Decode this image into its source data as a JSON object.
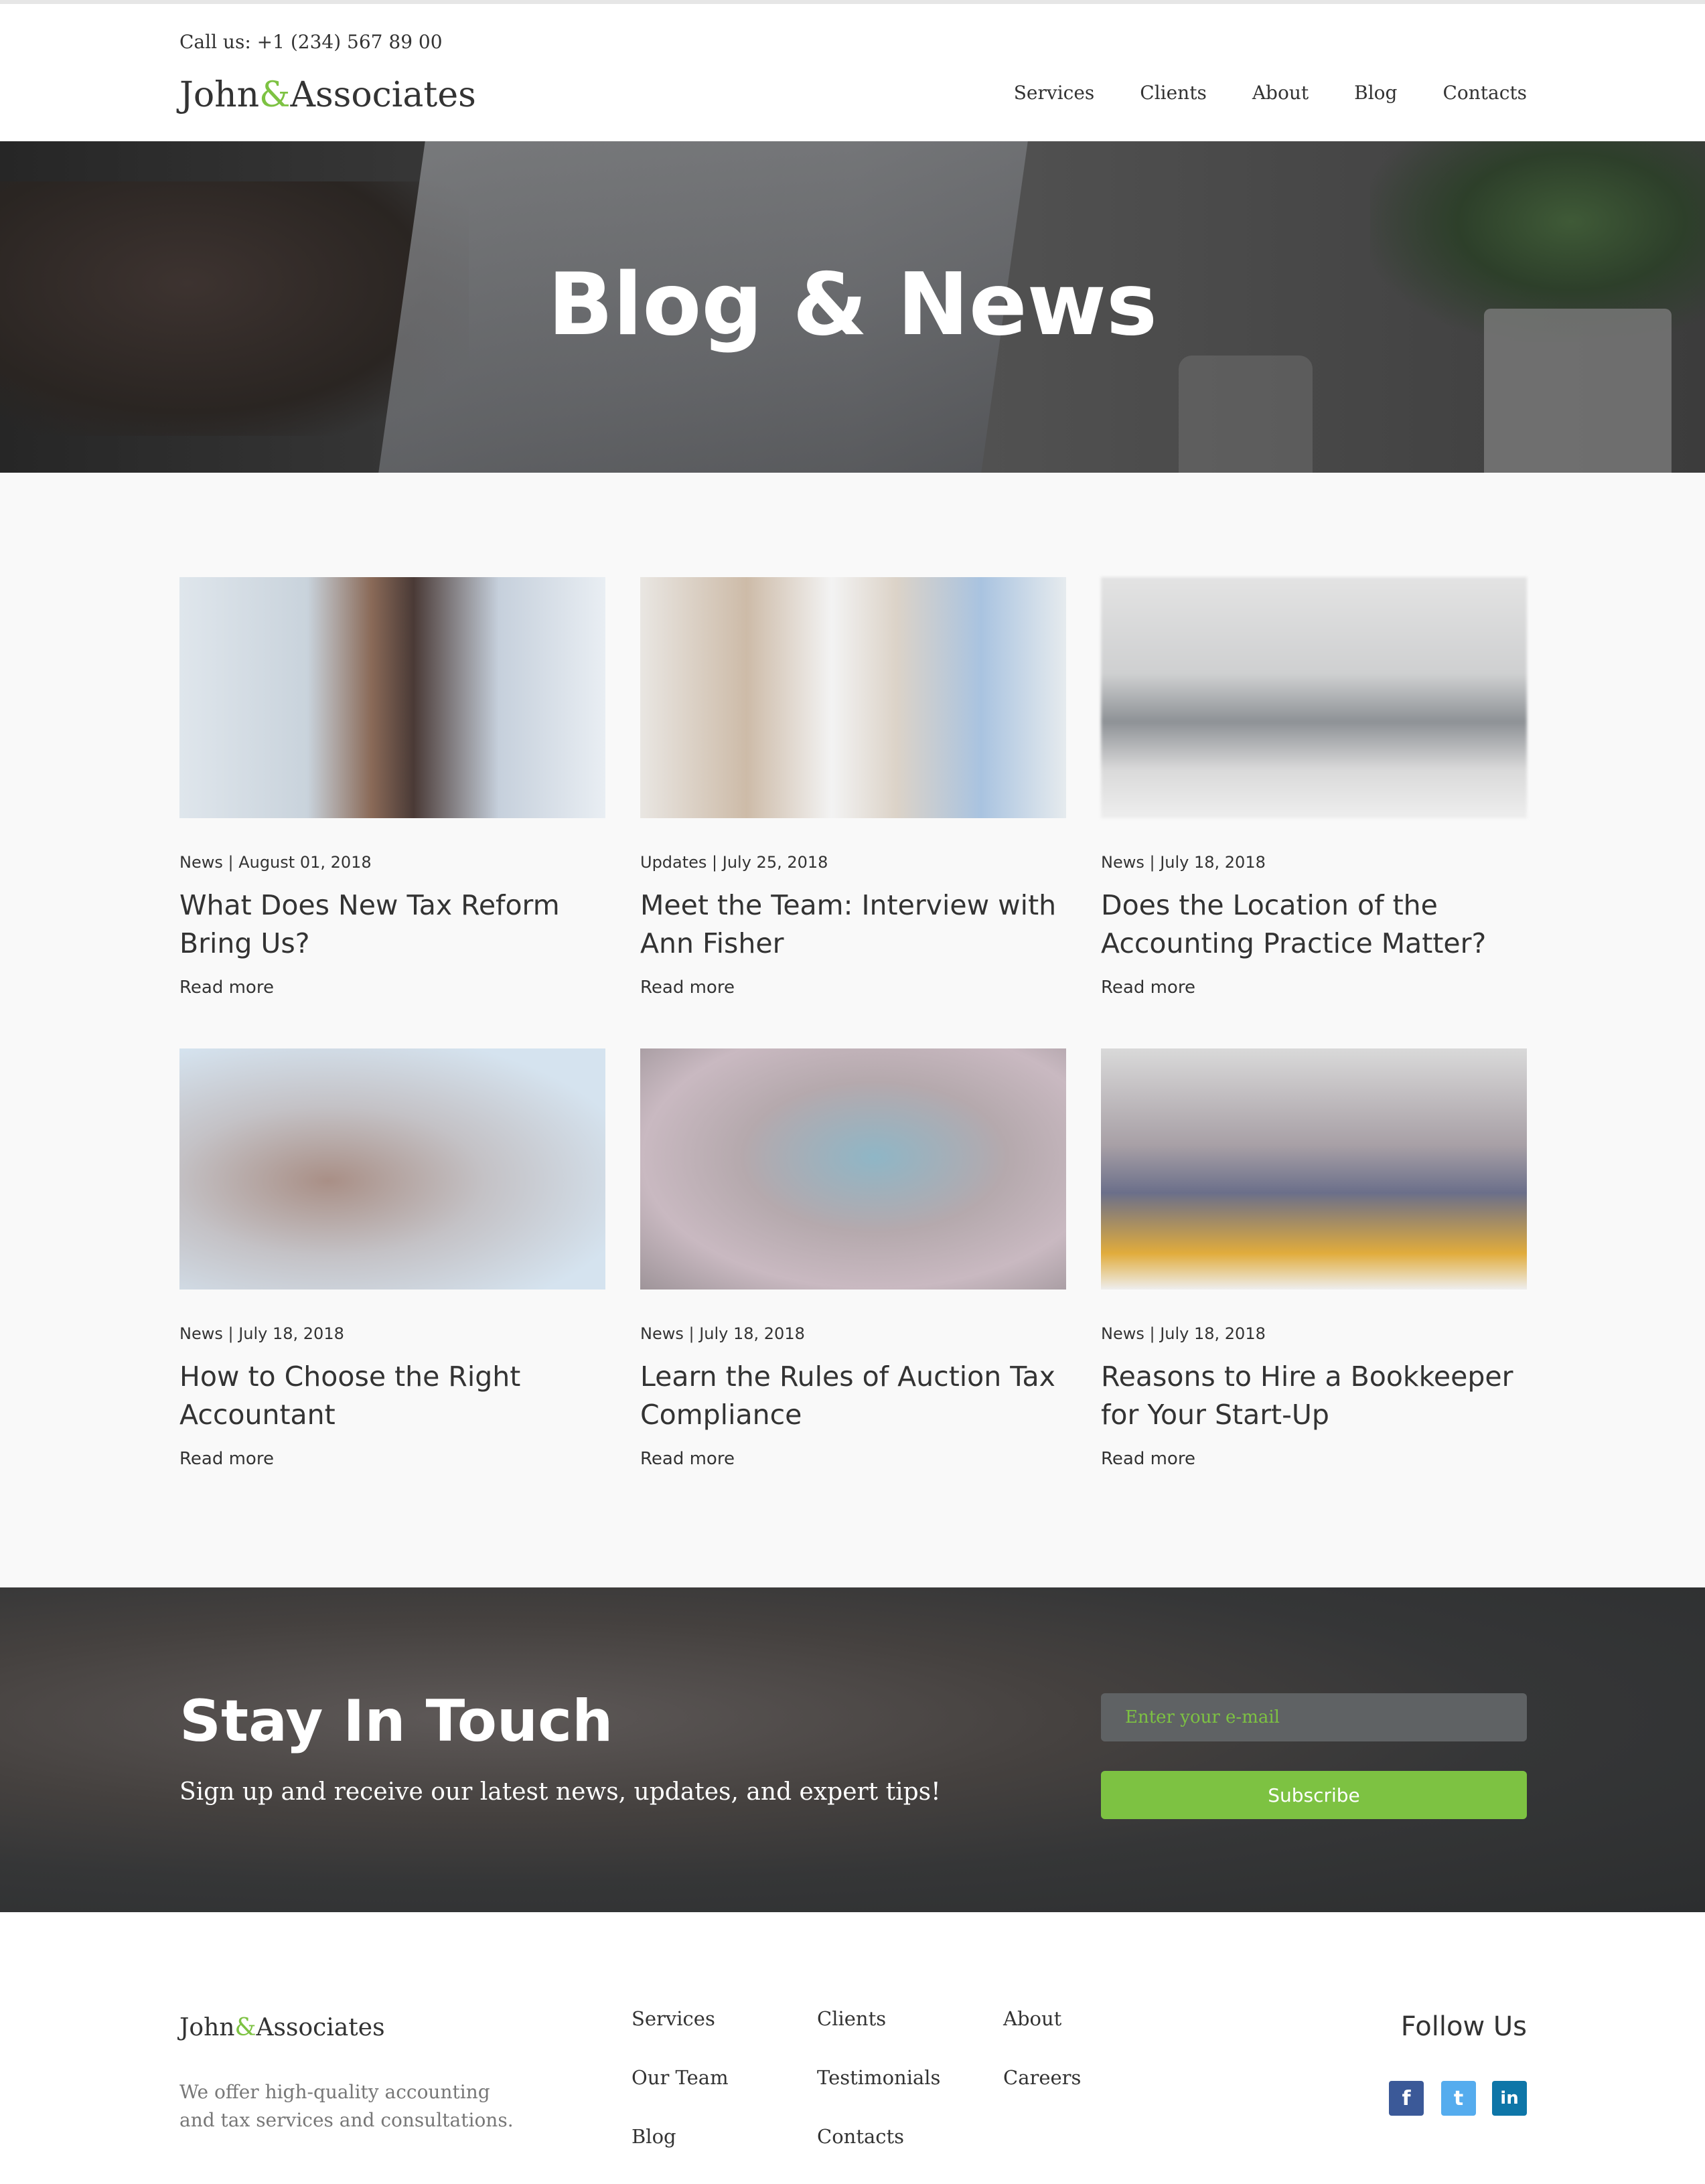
{
  "header": {
    "call_us": "Call us: +1 (234) 567 89 00",
    "logo_left": "John",
    "logo_amp": "&",
    "logo_right": "Associates",
    "nav": [
      "Services",
      "Clients",
      "About",
      "Blog",
      "Contacts"
    ]
  },
  "hero": {
    "title": "Blog & News"
  },
  "posts": [
    {
      "meta": "News | August 01, 2018",
      "title": "What Does New Tax Reform Bring Us?",
      "read_more": "Read more"
    },
    {
      "meta": "Updates | July 25, 2018",
      "title": "Meet the Team: Interview with Ann Fisher",
      "read_more": "Read more"
    },
    {
      "meta": "News | July 18, 2018",
      "title": "Does the Location of the Accounting Practice Matter?",
      "read_more": "Read more"
    },
    {
      "meta": "News | July 18, 2018",
      "title": "How to Choose the Right Accountant",
      "read_more": "Read more"
    },
    {
      "meta": "News | July 18, 2018",
      "title": "Learn the Rules of Auction Tax Compliance",
      "read_more": "Read more"
    },
    {
      "meta": "News | July 18, 2018",
      "title": "Reasons to Hire a Bookkeeper for Your Start-Up",
      "read_more": "Read more"
    }
  ],
  "subscribe": {
    "title": "Stay In Touch",
    "subtitle": "Sign up and receive our latest news, updates, and expert tips!",
    "email_placeholder": "Enter your e-mail",
    "button": "Subscribe"
  },
  "footer": {
    "logo_left": "John",
    "logo_amp": "&",
    "logo_right": "Associates",
    "description": "We offer high-quality accounting and tax services and consultations.",
    "col1": [
      "Services",
      "Our Team",
      "Blog"
    ],
    "col2": [
      "Clients",
      "Testimonials",
      "Contacts"
    ],
    "col3": [
      "About",
      "Careers"
    ],
    "follow_title": "Follow Us",
    "social": [
      {
        "icon": "facebook-icon",
        "glyph": "f",
        "color": "#3b5998"
      },
      {
        "icon": "twitter-icon",
        "glyph": "t",
        "color": "#55acee"
      },
      {
        "icon": "linkedin-icon",
        "glyph": "in",
        "color": "#0e76a8"
      }
    ]
  },
  "colors": {
    "accent": "#7dc242",
    "posts_bg": "#f9f9f9"
  }
}
